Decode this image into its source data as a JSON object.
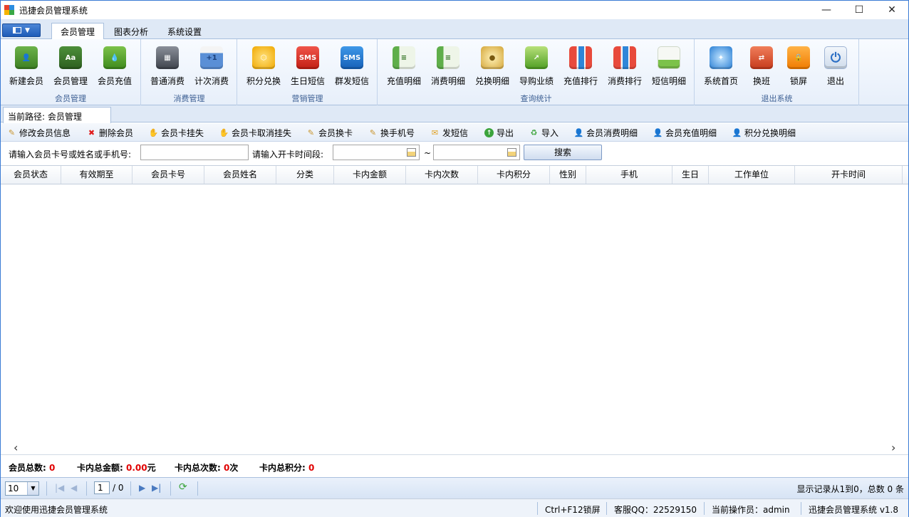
{
  "window": {
    "title": "迅捷会员管理系统",
    "minimize": "—",
    "maximize": "☐",
    "close": "✕"
  },
  "menu": {
    "tabs": [
      {
        "label": "会员管理"
      },
      {
        "label": "图表分析"
      },
      {
        "label": "系统设置"
      }
    ]
  },
  "ribbon": {
    "groups": [
      {
        "label": "会员管理",
        "buttons": [
          {
            "label": "新建会员",
            "icon": "new-member-book-icon"
          },
          {
            "label": "会员管理",
            "icon": "member-book-icon"
          },
          {
            "label": "会员充值",
            "icon": "recharge-drop-icon"
          }
        ]
      },
      {
        "label": "消费管理",
        "buttons": [
          {
            "label": "普通消费",
            "icon": "cash-register-icon"
          },
          {
            "label": "计次消费",
            "icon": "calendar-plus-icon"
          }
        ]
      },
      {
        "label": "营销管理",
        "buttons": [
          {
            "label": "积分兑换",
            "icon": "points-exchange-icon"
          },
          {
            "label": "生日短信",
            "icon": "sms-red-icon"
          },
          {
            "label": "群发短信",
            "icon": "sms-blue-icon"
          }
        ]
      },
      {
        "label": "查询统计",
        "buttons": [
          {
            "label": "充值明细",
            "icon": "recharge-sheet-icon"
          },
          {
            "label": "消费明细",
            "icon": "consume-sheet-icon"
          },
          {
            "label": "兑换明细",
            "icon": "coins-icon"
          },
          {
            "label": "导购业绩",
            "icon": "trend-up-icon"
          },
          {
            "label": "充值排行",
            "icon": "bar-chart-icon"
          },
          {
            "label": "消费排行",
            "icon": "bar-chart-icon"
          },
          {
            "label": "短信明细",
            "icon": "sms-sheet-icon"
          }
        ]
      },
      {
        "label": "退出系统",
        "buttons": [
          {
            "label": "系统首页",
            "icon": "compass-icon"
          },
          {
            "label": "换班",
            "icon": "swap-icon"
          },
          {
            "label": "锁屏",
            "icon": "lock-icon"
          },
          {
            "label": "退出",
            "icon": "power-icon"
          }
        ]
      }
    ],
    "sms_text": "SMS"
  },
  "path": {
    "label": "当前路径: 会员管理"
  },
  "toolbar": {
    "items": [
      {
        "label": "修改会员信息",
        "icon": "edit-pencil-icon"
      },
      {
        "label": "删除会员",
        "icon": "delete-x-icon"
      },
      {
        "label": "会员卡挂失",
        "icon": "report-loss-icon"
      },
      {
        "label": "会员卡取消挂失",
        "icon": "cancel-loss-icon"
      },
      {
        "label": "会员换卡",
        "icon": "change-card-icon"
      },
      {
        "label": "换手机号",
        "icon": "change-phone-icon"
      },
      {
        "label": "发短信",
        "icon": "send-sms-icon"
      },
      {
        "label": "导出",
        "icon": "export-icon"
      },
      {
        "label": "导入",
        "icon": "import-icon"
      },
      {
        "label": "会员消费明细",
        "icon": "member-consume-icon"
      },
      {
        "label": "会员充值明细",
        "icon": "member-recharge-icon"
      },
      {
        "label": "积分兑换明细",
        "icon": "points-detail-icon"
      }
    ]
  },
  "search": {
    "keyword_label": "请输入会员卡号或姓名或手机号:",
    "keyword_value": "",
    "date_label": "请输入开卡时间段:",
    "date_from": "",
    "date_to": "",
    "tilde": "~",
    "button": "搜索"
  },
  "table": {
    "columns": [
      "会员状态",
      "有效期至",
      "会员卡号",
      "会员姓名",
      "分类",
      "卡内金额",
      "卡内次数",
      "卡内积分",
      "性别",
      "手机",
      "生日",
      "工作单位",
      "开卡时间"
    ],
    "rows": []
  },
  "summary": {
    "total_members_label": "会员总数:",
    "total_members": "0",
    "total_amount_label": "卡内总金额:",
    "total_amount": "0.00",
    "amount_unit": "元",
    "total_count_label": "卡内总次数:",
    "total_count": "0",
    "count_unit": "次",
    "total_points_label": "卡内总积分:",
    "total_points": "0"
  },
  "pager": {
    "page_size": "10",
    "current_page": "1",
    "total_pages_text": "/ 0",
    "info": "显示记录从1到0，总数 0 条"
  },
  "status": {
    "welcome": "欢迎使用迅捷会员管理系统",
    "shortcut": "Ctrl+F12锁屏",
    "service_qq": "客服QQ：22529150",
    "operator": "当前操作员：admin",
    "version": "迅捷会员管理系统 v1.8"
  },
  "colors": {
    "accent": "#1e5cb8",
    "value_red": "#e00000"
  }
}
